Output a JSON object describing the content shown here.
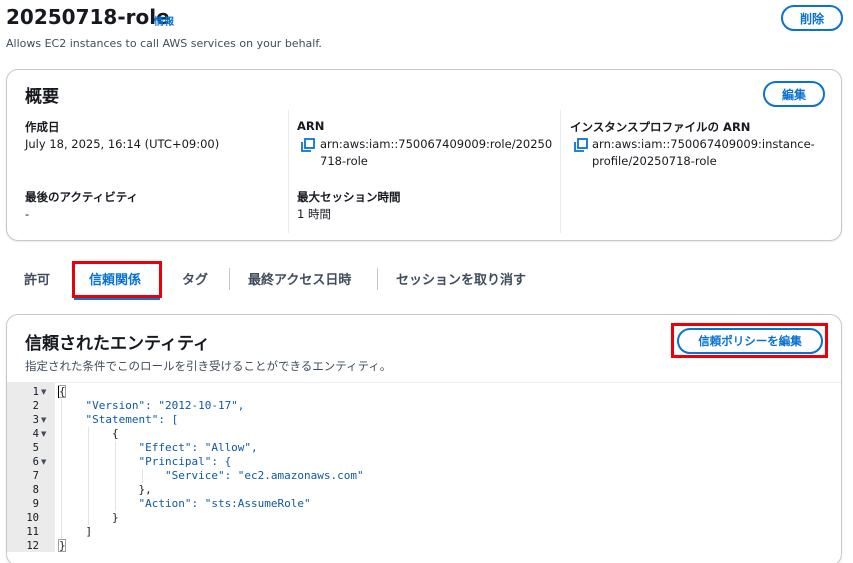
{
  "header": {
    "title": "20250718-role",
    "info_link": "情報",
    "description": "Allows EC2 instances to call AWS services on your behalf.",
    "delete_button": "削除"
  },
  "summary": {
    "title": "概要",
    "edit_button": "編集",
    "created_label": "作成日",
    "created_value": "July 18, 2025, 16:14 (UTC+09:00)",
    "last_activity_label": "最後のアクティビティ",
    "last_activity_value": "-",
    "arn_label": "ARN",
    "arn_line1": "arn:aws:iam::750067409009:role/20250",
    "arn_line2": "718-role",
    "max_session_label": "最大セッション時間",
    "max_session_value": "1 時間",
    "instance_profile_label": "インスタンスプロファイルの ARN",
    "instance_profile_line1": "arn:aws:iam::750067409009:instance-",
    "instance_profile_line2": "profile/20250718-role"
  },
  "tabs": [
    {
      "label": "許可",
      "active": false
    },
    {
      "label": "信頼関係",
      "active": true
    },
    {
      "label": "タグ",
      "active": false
    },
    {
      "label": "最終アクセス日時",
      "active": false
    },
    {
      "label": "セッションを取り消す",
      "active": false
    }
  ],
  "trusted": {
    "title": "信頼されたエンティティ",
    "subtitle": "指定された条件でこのロールを引き受けることができるエンティティ。",
    "edit_policy_button": "信頼ポリシーを編集"
  },
  "code": {
    "line_numbers": [
      "1",
      "2",
      "3",
      "4",
      "5",
      "6",
      "7",
      "8",
      "9",
      "10",
      "11",
      "12"
    ],
    "lines": [
      "{",
      "    \"Version\": \"2012-10-17\",",
      "    \"Statement\": [",
      "        {",
      "            \"Effect\": \"Allow\",",
      "            \"Principal\": {",
      "                \"Service\": \"ec2.amazonaws.com\"",
      "            },",
      "            \"Action\": \"sts:AssumeRole\"",
      "        }",
      "    ]",
      "}"
    ]
  },
  "colors": {
    "accent": "#0972d3",
    "highlight": "#e8000b",
    "text": "#16191f"
  }
}
